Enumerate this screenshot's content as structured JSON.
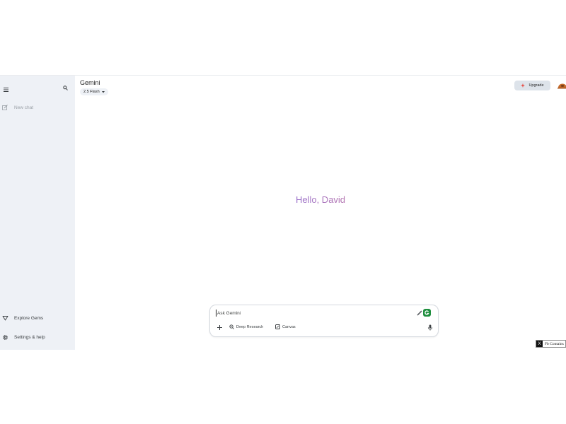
{
  "sidebar": {
    "new_chat": "New chat",
    "explore_gems": "Explore Gems",
    "settings_help": "Settings & help"
  },
  "header": {
    "title": "Gemini",
    "model": "2.5 Flash",
    "upgrade_label": "Upgrade"
  },
  "main": {
    "greeting": "Hello, David"
  },
  "composer": {
    "placeholder": "Ask Gemini",
    "tools": {
      "deep_research": "Deep Research",
      "canvas": "Canvas"
    }
  },
  "popup": {
    "close": "X",
    "label": "Fb Contains"
  },
  "colors": {
    "sidebar_bg": "#eef1f6",
    "upgrade_bg": "#dde3ea",
    "upgrade_star": "#e8453c",
    "greeting_start": "#4b84f2",
    "greeting_end": "#d96570",
    "extension_badge": "#1e8e3e"
  }
}
